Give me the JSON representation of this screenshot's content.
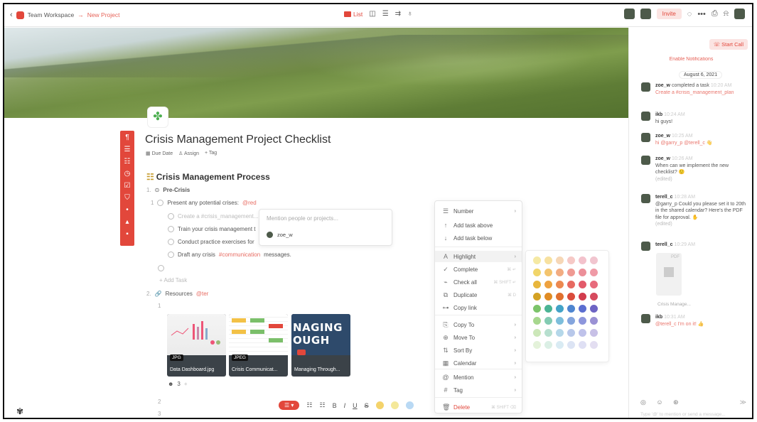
{
  "topbar": {
    "workspace": "Team Workspace",
    "arrow": "→",
    "project": "New Project",
    "list_tab": "List",
    "view_icons": [
      "◫",
      "☰",
      "⇉",
      "♁"
    ],
    "invite": "Invite",
    "top_icons": [
      "◌",
      "•••",
      "⎙",
      "⍾"
    ]
  },
  "doc": {
    "title": "Crisis Management Project Checklist",
    "meta": [
      "Due Date",
      "Assign",
      "+ Tag"
    ],
    "section_prefix": "☷",
    "section": "Crisis Management Process",
    "items": {
      "n1": "1.",
      "pre_crisis": "Pre-Crisis",
      "n1_1": "1",
      "present": "Present any potential crises:",
      "present_chip": "@red",
      "create": "Create a #crisis_management...",
      "train": "Train your crisis management t",
      "conduct": "Conduct practice exercises for",
      "draft_pre": "Draft any crisis",
      "draft_tag": "#communication",
      "draft_post": "messages.",
      "add_task": "+ Add Task",
      "n2": "2.",
      "resources": "Resources",
      "resources_chip": "@ter",
      "r1": "1",
      "reactions": "3",
      "n2_2": "2",
      "n3": "3"
    },
    "mention_placeholder": "Mention people or projects...",
    "mention_user": "zoe_w"
  },
  "thumbnails": [
    {
      "badge": "JPG",
      "label": "Data Dashboard.jpg"
    },
    {
      "badge": "JPEG",
      "label": "Crisis Communicat..."
    },
    {
      "badge": "",
      "label": "Managing Through...",
      "big_text": "NAGING\nOUGH"
    }
  ],
  "format_bar": {
    "pill": "☰ ▾",
    "icons": [
      "☷",
      "☷",
      "B",
      "I",
      "U",
      "S"
    ],
    "dot_colors": [
      "#f4d36b",
      "#f4e89a",
      "#b9d9f4"
    ]
  },
  "context_menu": {
    "items": [
      {
        "icon": "☰",
        "label": "Number",
        "arrow": "›"
      },
      {
        "icon": "↑",
        "label": "Add task above"
      },
      {
        "icon": "↓",
        "label": "Add task below"
      },
      {
        "icon": "A",
        "label": "Highlight",
        "arrow": "›"
      },
      {
        "icon": "✓",
        "label": "Complete",
        "kbd": "⌘ ↵"
      },
      {
        "icon": "⌁",
        "label": "Check all",
        "kbd": "⌘ SHIFT ↵"
      },
      {
        "icon": "⧉",
        "label": "Duplicate",
        "kbd": "⌘ D"
      },
      {
        "icon": "⊶",
        "label": "Copy link"
      },
      {
        "icon": "⎘",
        "label": "Copy To",
        "arrow": "›"
      },
      {
        "icon": "⊕",
        "label": "Move To",
        "arrow": "›"
      },
      {
        "icon": "⇅",
        "label": "Sort By",
        "arrow": "›"
      },
      {
        "icon": "▦",
        "label": "Calendar",
        "arrow": "›"
      },
      {
        "icon": "@",
        "label": "Mention",
        "arrow": "›"
      },
      {
        "icon": "#",
        "label": "Tag",
        "arrow": "›"
      },
      {
        "icon": "🗑",
        "label": "Delete",
        "kbd": "⌘ SHIFT ⌫"
      }
    ]
  },
  "palette_colors": [
    [
      "#f5e9a4",
      "#f7e1a0",
      "#f6d7b6",
      "#f6c9c6",
      "#f3c2cc",
      "#f1c5cf"
    ],
    [
      "#f1d56a",
      "#f3c46e",
      "#f2ac82",
      "#ef9a93",
      "#ec8f99",
      "#ef9aa6"
    ],
    [
      "#e8b63c",
      "#eea23f",
      "#ec8950",
      "#e76a61",
      "#e35a6a",
      "#e76b7c"
    ],
    [
      "#d4a224",
      "#e08c25",
      "#e0702f",
      "#da4c3c",
      "#d23c4d",
      "#d64a5e"
    ],
    [
      "#7cc46a",
      "#4bb494",
      "#43a3c7",
      "#4e85d0",
      "#5b6ed0",
      "#6d64c4"
    ],
    [
      "#a7d78e",
      "#83cbb2",
      "#7dbedb",
      "#84a5dd",
      "#8d96dc",
      "#9a91d4"
    ],
    [
      "#cce7b9",
      "#b7dfcf",
      "#b4d7e9",
      "#b8c8ea",
      "#bfc2ea",
      "#c7c0e6"
    ],
    [
      "#e4f2da",
      "#dbefe5",
      "#d9ebf3",
      "#dce4f4",
      "#dfe0f4",
      "#e3def1"
    ]
  ],
  "right_panel": {
    "start_call": "Start Call",
    "enable": "Enable Notifications",
    "date": "August 6, 2021",
    "messages": [
      {
        "who": "zoe_w",
        "text": "completed a task",
        "time": "10:20 AM",
        "extra": "Create a #crisis_management_plan"
      },
      {
        "who": "ikb",
        "time": "10:24 AM",
        "text": "hi guys!"
      },
      {
        "who": "zoe_w",
        "time": "10:25 AM",
        "text": "hi @garry_p @terell_c 👋"
      },
      {
        "who": "zoe_w",
        "time": "10:26 AM",
        "text": "When can we implement the new checklist? 🙂",
        "edited": "(edited)"
      },
      {
        "who": "terell_c",
        "time": "10:28 AM",
        "text": "@garry_p Could you please set it to 20th in the shared calendar? Here's the PDF file for approval. ✋",
        "edited": "(edited)"
      },
      {
        "who": "terell_c",
        "time": "10:29 AM",
        "file": "Crisis Manage...",
        "pdf": "PDF"
      },
      {
        "who": "ikb",
        "time": "10:31 AM",
        "text": "@terell_c I'm on it! 👍"
      }
    ],
    "composer_icons": "◎ ☺ ⊛",
    "send": "≫",
    "composer_placeholder": "Type '@' to mention or send a message..."
  }
}
